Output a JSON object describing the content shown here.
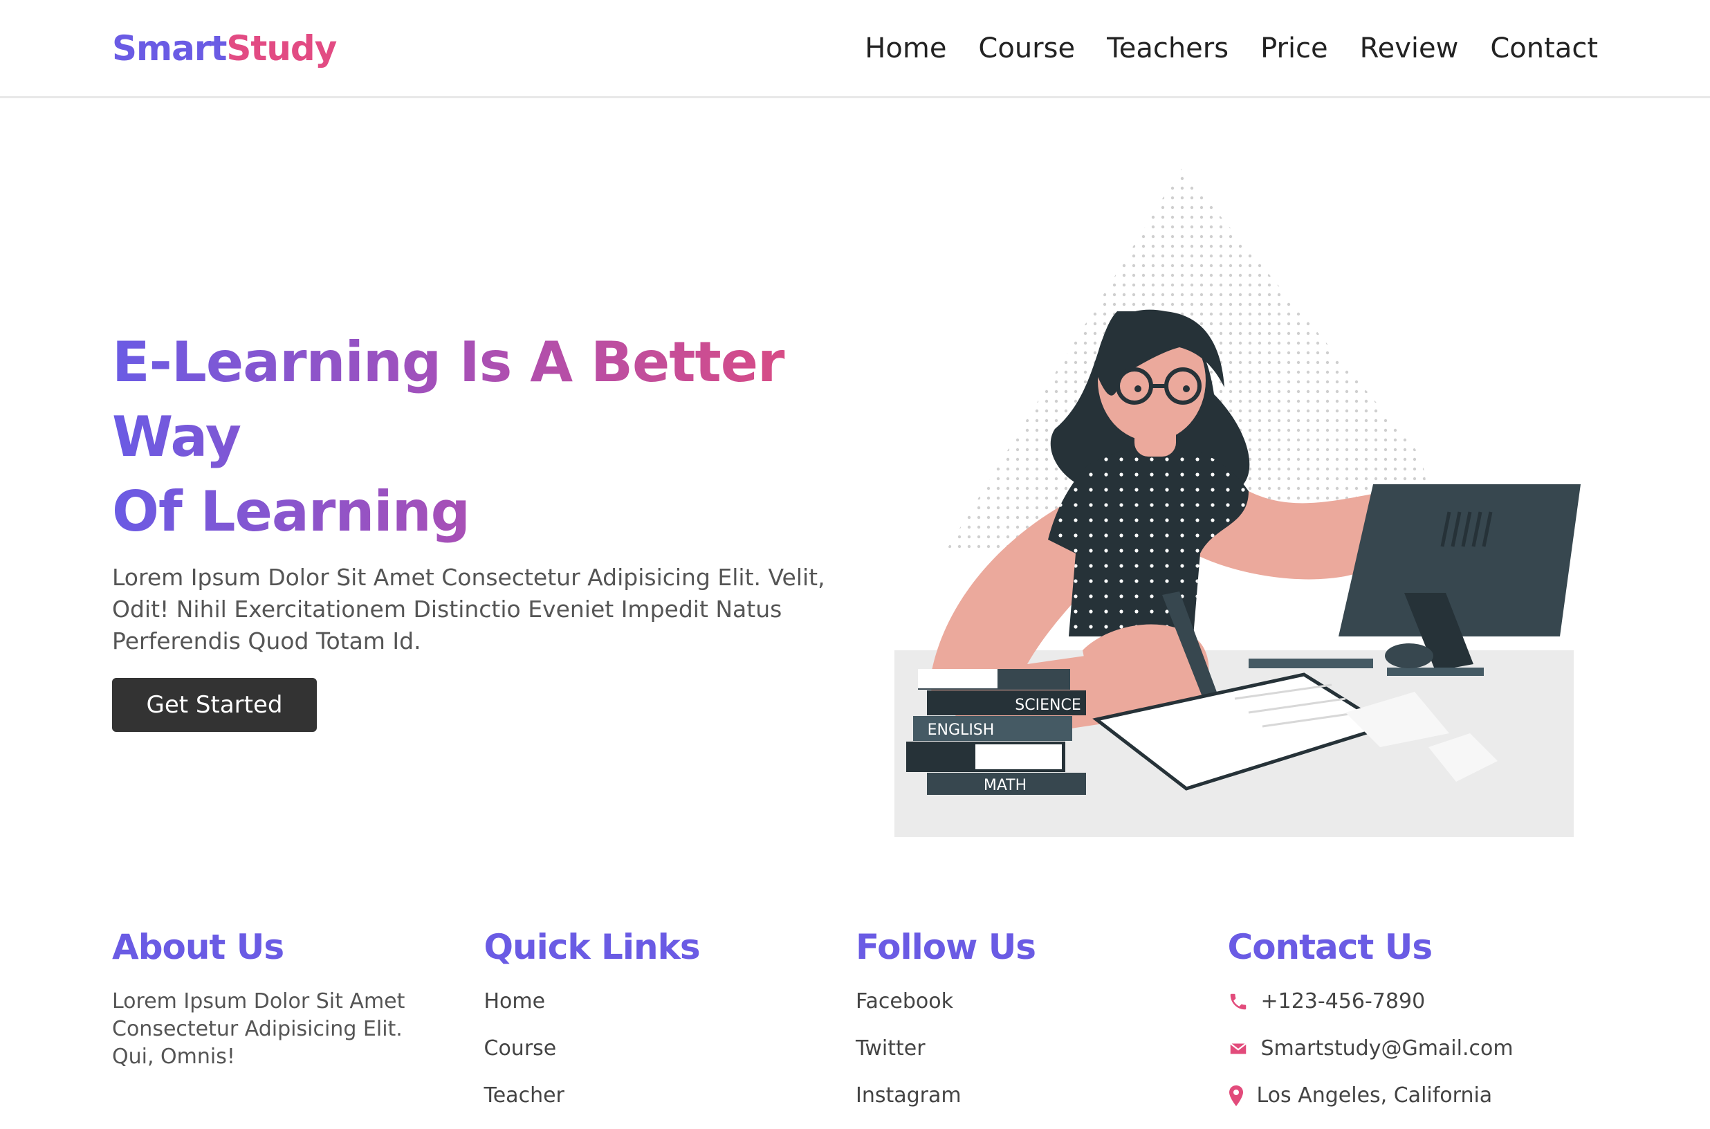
{
  "brand": {
    "part1": "Smart",
    "part2": "Study"
  },
  "nav": [
    "Home",
    "Course",
    "Teachers",
    "Price",
    "Review",
    "Contact"
  ],
  "hero": {
    "title_line1": "E-Learning Is A Better Way",
    "title_line2": "Of Learning",
    "description": "Lorem Ipsum Dolor Sit Amet Consectetur Adipisicing Elit. Velit, Odit! Nihil Exercitationem Distinctio Eveniet Impedit Natus Perferendis Quod Totam Id.",
    "cta_label": "Get Started"
  },
  "illustration": {
    "book_labels": [
      "SCIENCE",
      "ENGLISH",
      "MATH"
    ]
  },
  "footer": {
    "about": {
      "title": "About Us",
      "text": "Lorem Ipsum Dolor Sit Amet Consectetur Adipisicing Elit. Qui, Omnis!"
    },
    "quick_links": {
      "title": "Quick Links",
      "items": [
        "Home",
        "Course",
        "Teacher"
      ]
    },
    "follow": {
      "title": "Follow Us",
      "items": [
        "Facebook",
        "Twitter",
        "Instagram"
      ]
    },
    "contact": {
      "title": "Contact Us",
      "phone": "+123-456-7890",
      "email": "Smartstudy@Gmail.com",
      "location": "Los Angeles, California"
    }
  },
  "colors": {
    "brand_purple": "#6a5be4",
    "brand_pink": "#e24b83",
    "button_dark": "#333333"
  },
  "icons": [
    "phone-icon",
    "envelope-icon",
    "map-pin-icon"
  ]
}
